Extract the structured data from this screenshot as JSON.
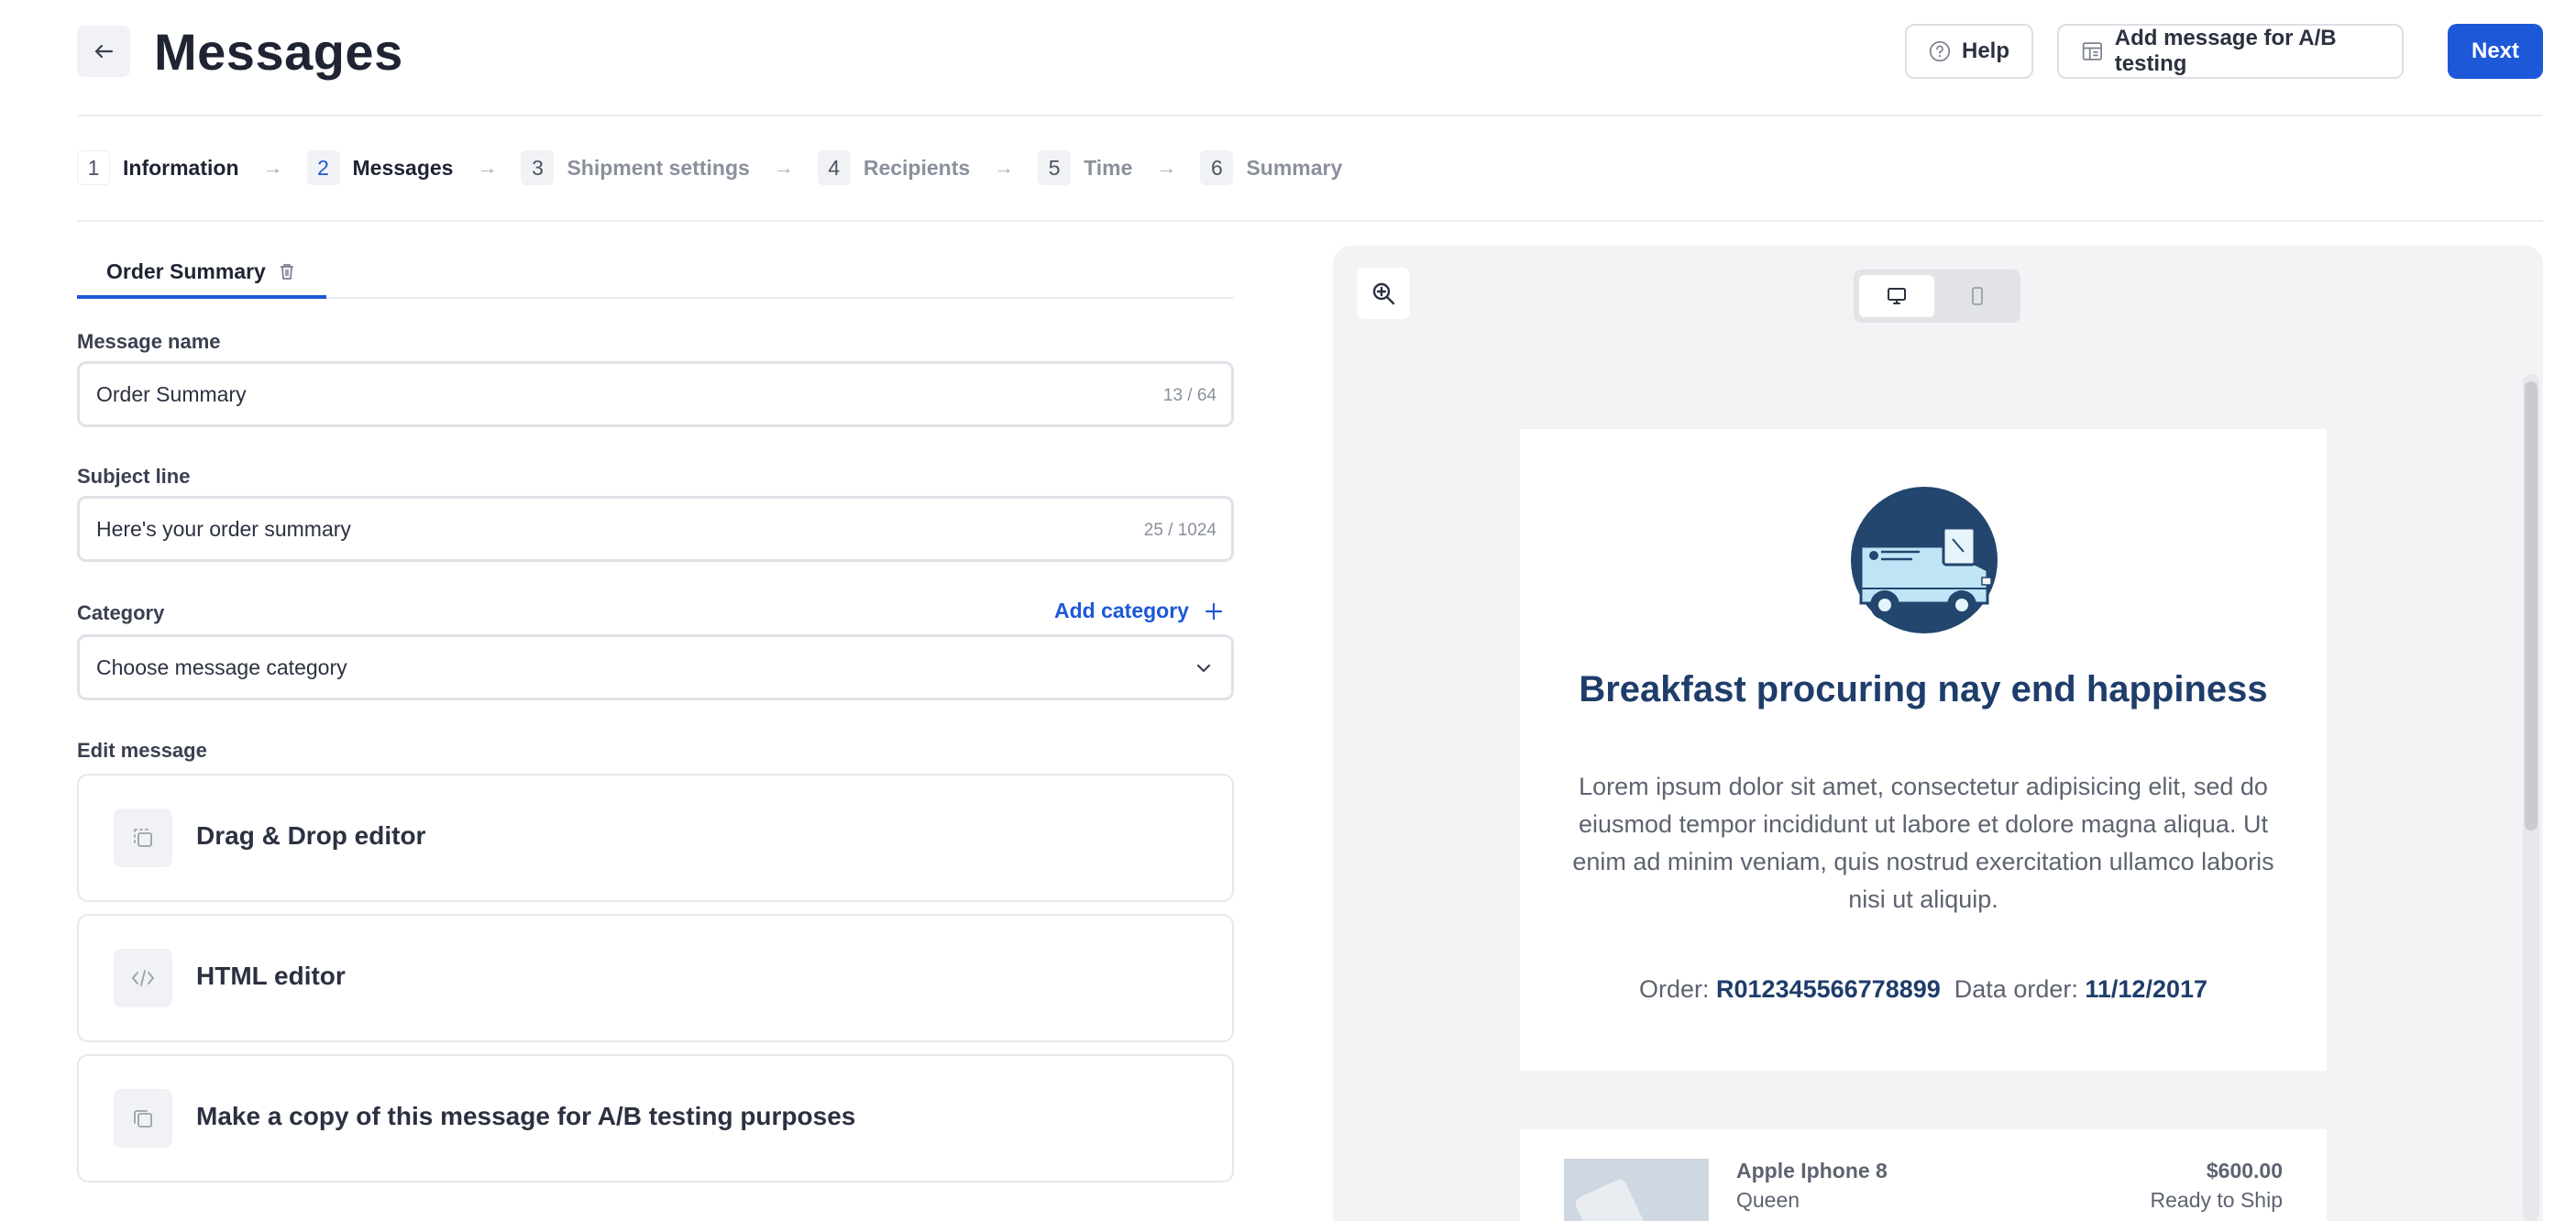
{
  "header": {
    "title": "Messages",
    "help_label": "Help",
    "ab_label": "Add message for A/B testing",
    "next_label": "Next"
  },
  "stepper": [
    {
      "num": "1",
      "label": "Information",
      "state": "done"
    },
    {
      "num": "2",
      "label": "Messages",
      "state": "current"
    },
    {
      "num": "3",
      "label": "Shipment settings",
      "state": "upcoming"
    },
    {
      "num": "4",
      "label": "Recipients",
      "state": "upcoming"
    },
    {
      "num": "5",
      "label": "Time",
      "state": "upcoming"
    },
    {
      "num": "6",
      "label": "Summary",
      "state": "upcoming"
    }
  ],
  "tabs": [
    {
      "label": "Order Summary"
    }
  ],
  "form": {
    "message_name": {
      "label": "Message name",
      "value": "Order Summary",
      "counter": "13 / 64"
    },
    "subject": {
      "label": "Subject line",
      "value": "Here's your order summary",
      "counter": "25 / 1024"
    },
    "category": {
      "label": "Category",
      "add_label": "Add category",
      "placeholder": "Choose message category"
    },
    "edit_label": "Edit message"
  },
  "editors": [
    {
      "label": "Drag & Drop editor",
      "icon": "drag-drop-icon"
    },
    {
      "label": "HTML editor",
      "icon": "code-icon"
    },
    {
      "label": "Make a copy of this message for A/B testing purposes",
      "icon": "copy-icon"
    }
  ],
  "preview": {
    "view_mode": "desktop",
    "email": {
      "heading": "Breakfast procuring nay end happiness",
      "body": "Lorem ipsum dolor sit amet, consectetur adipisicing elit, sed do eiusmod tempor incididunt ut labore et dolore magna aliqua. Ut enim ad minim veniam, quis nostrud exercitation ullamco laboris nisi ut aliquip.",
      "order_label": "Order:",
      "order_number": "R012345566778899",
      "date_label": "Data order:",
      "date_value": "11/12/2017"
    },
    "product": {
      "name": "Apple Iphone 8",
      "variant": "Queen",
      "price": "$600.00",
      "status": "Ready to Ship"
    }
  },
  "colors": {
    "accent": "#1d58d8",
    "email_heading": "#1e3d6b",
    "preview_bg": "#f2f3f5"
  }
}
